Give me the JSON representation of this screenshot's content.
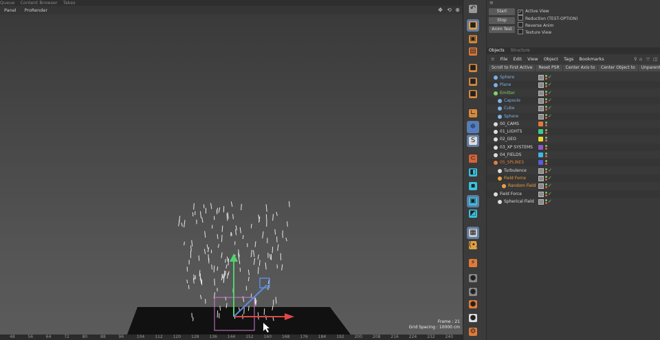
{
  "top_menu": [
    "Queue",
    "Content Browser",
    "Takes"
  ],
  "viewport_menu": [
    "Panel",
    "ProRender"
  ],
  "viewport": {
    "frame_label": "Frame : 21",
    "grid_spacing": "Grid Spacing : 10000 cm"
  },
  "ruler_ticks": [
    "48",
    "56",
    "64",
    "72",
    "80",
    "88",
    "96",
    "104",
    "112",
    "120",
    "128",
    "136",
    "144",
    "152",
    "160",
    "168",
    "176",
    "184",
    "192",
    "200",
    "208",
    "216",
    "224",
    "232",
    "240"
  ],
  "render_controls": {
    "start": "Start",
    "stop": "Stop",
    "anim_test": "Anim Test",
    "options": [
      {
        "label": "Active View",
        "checked": true
      },
      {
        "label": "Reduction (TEST-OPTION)",
        "checked": false
      },
      {
        "label": "Reverse Anim",
        "checked": false
      },
      {
        "label": "Texture View",
        "checked": false
      }
    ]
  },
  "object_manager": {
    "tabs": [
      "Objects",
      "Structure"
    ],
    "menu": [
      "File",
      "Edit",
      "View",
      "Object",
      "Tags",
      "Bookmarks"
    ],
    "actions": [
      "Scroll to First Active",
      "Reset PSR",
      "Center Axis to",
      "Center Object to",
      "Unparent"
    ],
    "items": [
      {
        "name": "Sphere",
        "indent": 1,
        "icon": "sphere-icon",
        "color": "#7ab3e8",
        "tag": ""
      },
      {
        "name": "Plane",
        "indent": 1,
        "icon": "plane-icon",
        "color": "#7ab3e8",
        "tag": ""
      },
      {
        "name": "Emitter",
        "indent": 1,
        "icon": "emitter-icon",
        "color": "#7fd36a",
        "tag": ""
      },
      {
        "name": "Capsule",
        "indent": 2,
        "icon": "capsule-icon",
        "color": "#7ab3e8",
        "tag": ""
      },
      {
        "name": "Cube",
        "indent": 2,
        "icon": "cube-icon",
        "color": "#7ab3e8",
        "tag": ""
      },
      {
        "name": "Sphere",
        "indent": 2,
        "icon": "sphere-icon",
        "color": "#7ab3e8",
        "tag": ""
      },
      {
        "name": "00_CAMS",
        "indent": 1,
        "icon": "layer-icon",
        "color": "#dddddd",
        "tag": "#e07b39"
      },
      {
        "name": "01_LIGHTS",
        "indent": 1,
        "icon": "layer-icon",
        "color": "#dddddd",
        "tag": "#3ec98a"
      },
      {
        "name": "02_GEO",
        "indent": 1,
        "icon": "layer-icon",
        "color": "#dddddd",
        "tag": "#e8d53a"
      },
      {
        "name": "03_XP SYSTEMS",
        "indent": 1,
        "icon": "layer-icon",
        "color": "#dddddd",
        "tag": "#8a5ac9"
      },
      {
        "name": "04_FIELDS",
        "indent": 1,
        "icon": "layer-icon",
        "color": "#dddddd",
        "tag": "#3fb6e8"
      },
      {
        "name": "05_SPLINES",
        "indent": 1,
        "icon": "layer-icon",
        "color": "#e0803a",
        "tag": "#5a5ae0"
      },
      {
        "name": "Turbulence",
        "indent": 2,
        "icon": "turbulence-icon",
        "color": "#dddddd",
        "tag": ""
      },
      {
        "name": "Field Force",
        "indent": 2,
        "icon": "field-force-icon",
        "color": "#f0a040",
        "tag": ""
      },
      {
        "name": "Random Field",
        "indent": 3,
        "icon": "random-field-icon",
        "color": "#f0a040",
        "tag": ""
      },
      {
        "name": "Field Force",
        "indent": 1,
        "icon": "field-force-icon",
        "color": "#dddddd",
        "tag": ""
      },
      {
        "name": "Spherical Field",
        "indent": 2,
        "icon": "spherical-field-icon",
        "color": "#dddddd",
        "tag": ""
      }
    ]
  }
}
